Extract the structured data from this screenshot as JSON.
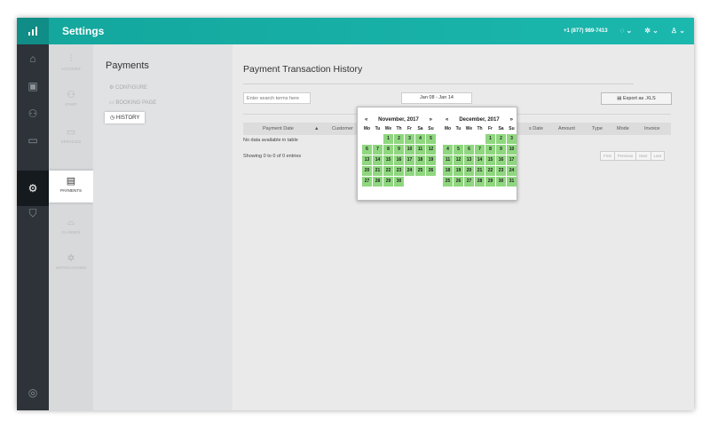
{
  "app": {
    "title": "Settings",
    "phone": "+1 (877) 989-7413"
  },
  "colors": {
    "topbar": "#17b0a6",
    "rail": "#2d3339",
    "day_highlight": "#8fd77f"
  },
  "rail": {
    "icons": [
      "home-icon",
      "calendar-icon",
      "users-icon",
      "laptop-icon",
      "gear-icon",
      "shield-icon",
      "lifebuoy-icon"
    ]
  },
  "sub_nav": {
    "items": [
      "ACCOUNT",
      "STAFF",
      "SERVICES",
      "PAYMENTS",
      "CLASSES",
      "NOTIFICATIONS"
    ]
  },
  "panel": {
    "title": "Payments",
    "items": [
      "CONFIGURE",
      "BOOKING PAGE",
      "HISTORY"
    ]
  },
  "main": {
    "title": "Payment Transaction History",
    "search_placeholder": "Enter search terms here",
    "date_range": "Jan 08 - Jan 14",
    "export_label": "Export as .XLS",
    "columns": [
      "Payment Date",
      "Customer",
      "s Date",
      "Amount",
      "Type",
      "Mode",
      "Invoice"
    ],
    "no_data": "No data available in table",
    "showing": "Showing 0 to 0 of 0 entries",
    "pager": [
      "First",
      "Previous",
      "Next",
      "Last"
    ]
  },
  "calendar": {
    "prev": "«",
    "next": "»",
    "day_names": [
      "Mo",
      "Tu",
      "We",
      "Th",
      "Fr",
      "Sa",
      "Su"
    ],
    "months": [
      {
        "label": "November, 2017",
        "weeks": [
          [
            "",
            "",
            "1",
            "2",
            "3",
            "4",
            "5"
          ],
          [
            "6",
            "7",
            "8",
            "9",
            "10",
            "11",
            "12"
          ],
          [
            "13",
            "14",
            "15",
            "16",
            "17",
            "18",
            "19"
          ],
          [
            "20",
            "21",
            "22",
            "23",
            "24",
            "25",
            "26"
          ],
          [
            "27",
            "28",
            "29",
            "30",
            "",
            "",
            ""
          ]
        ]
      },
      {
        "label": "December, 2017",
        "weeks": [
          [
            "",
            "",
            "",
            "",
            "1",
            "2",
            "3"
          ],
          [
            "4",
            "5",
            "6",
            "7",
            "8",
            "9",
            "10"
          ],
          [
            "11",
            "12",
            "13",
            "14",
            "15",
            "16",
            "17"
          ],
          [
            "18",
            "19",
            "20",
            "21",
            "22",
            "23",
            "24"
          ],
          [
            "25",
            "26",
            "27",
            "28",
            "29",
            "30",
            "31"
          ]
        ]
      }
    ]
  }
}
